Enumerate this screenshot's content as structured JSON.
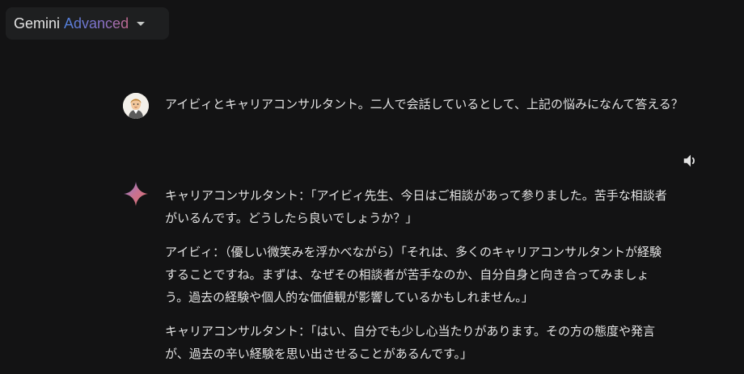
{
  "header": {
    "model_name": "Gemini",
    "model_tier": "Advanced",
    "dropdown_icon": "chevron-down-icon"
  },
  "conversation": {
    "user_prompt": {
      "avatar_icon": "user-avatar",
      "text": "アイビィとキャリアコンサルタント。二人で会話しているとして、上記の悩みになんて答える？"
    },
    "response": {
      "icon": "gemini-sparkle-icon",
      "tts_icon": "speaker-icon",
      "paragraphs": [
        "キャリアコンサルタント：「アイビィ先生、今日はご相談があって参りました。苦手な相談者がいるんです。どうしたら良いでしょうか？」",
        "アイビィ：（優しい微笑みを浮かべながら）「それは、多くのキャリアコンサルタントが経験することですね。まずは、なぜその相談者が苦手なのか、自分自身と向き合ってみましょう。過去の経験や個人的な価値観が影響しているかもしれません。」",
        "キャリアコンサルタント：「はい、自分でも少し心当たりがあります。その方の態度や発言が、過去の辛い経験を思い出させることがあるんです。」"
      ]
    }
  },
  "colors": {
    "background": "#131314",
    "surface": "#1e1f20",
    "text": "#e3e3e3",
    "accent_blue": "#4f7fd9",
    "accent_pink": "#c26a8e"
  }
}
